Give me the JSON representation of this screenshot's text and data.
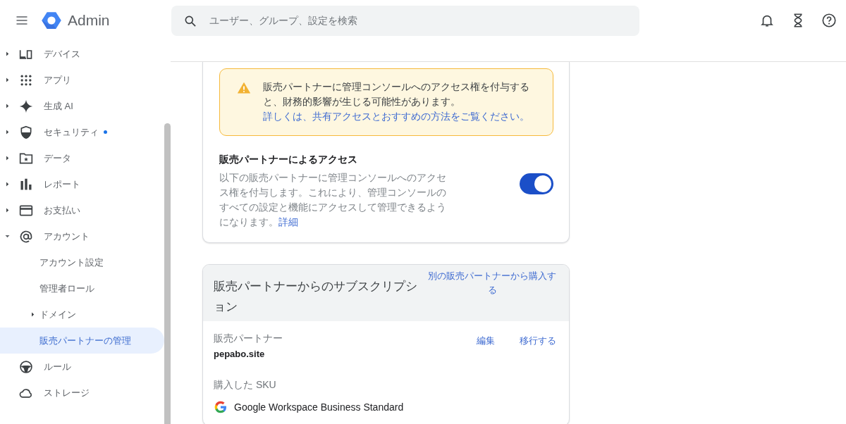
{
  "header": {
    "product": "Admin",
    "search": {
      "placeholder": "ユーザー、グループ、設定を検索"
    }
  },
  "sidebar": {
    "items": [
      {
        "label": "デバイス",
        "expandable": true,
        "expanded": false,
        "selected": false,
        "notification": false
      },
      {
        "label": "アプリ",
        "expandable": true,
        "expanded": false,
        "selected": false,
        "notification": false
      },
      {
        "label": "生成 AI",
        "expandable": true,
        "expanded": false,
        "selected": false,
        "notification": false
      },
      {
        "label": "セキュリティ",
        "expandable": true,
        "expanded": false,
        "selected": false,
        "notification": true
      },
      {
        "label": "データ",
        "expandable": true,
        "expanded": false,
        "selected": false,
        "notification": false
      },
      {
        "label": "レポート",
        "expandable": true,
        "expanded": false,
        "selected": false,
        "notification": false
      },
      {
        "label": "お支払い",
        "expandable": true,
        "expanded": false,
        "selected": false,
        "notification": false
      },
      {
        "label": "アカウント",
        "expandable": true,
        "expanded": true,
        "selected": false,
        "notification": false,
        "children": [
          {
            "label": "アカウント設定",
            "expandable": false,
            "expanded": false,
            "selected": false,
            "notification": false
          },
          {
            "label": "管理者ロール",
            "expandable": false,
            "expanded": false,
            "selected": false,
            "notification": false
          },
          {
            "label": "ドメイン",
            "expandable": true,
            "expanded": false,
            "selected": false,
            "notification": false
          },
          {
            "label": "販売パートナーの管理",
            "expandable": false,
            "expanded": false,
            "selected": true,
            "notification": false
          }
        ]
      },
      {
        "label": "ルール",
        "expandable": false,
        "expanded": false,
        "selected": false,
        "notification": false
      },
      {
        "label": "ストレージ",
        "expandable": false,
        "expanded": false,
        "selected": false,
        "notification": false
      }
    ]
  },
  "access_card": {
    "warning": {
      "text": "販売パートナーに管理コンソールへのアクセス権を付与すると、財務的影響が生じる可能性があります。",
      "link": "詳しくは、共有アクセスとおすすめの方法をご覧ください。"
    },
    "setting": {
      "title": "販売パートナーによるアクセス",
      "description": "以下の販売パートナーに管理コンソールへのアクセス権を付与します。これにより、管理コンソールのすべての設定と機能にアクセスして管理できるようになります。",
      "link": "詳細",
      "on": true
    }
  },
  "subscription_card": {
    "title": "販売パートナーからのサブスクリプション",
    "action": "別の販売パートナーから購入する",
    "reseller": {
      "label": "販売パートナー",
      "value": "pepabo.site",
      "actions": [
        "編集",
        "移行する"
      ]
    },
    "sku": {
      "label": "購入した SKU",
      "product": "Google Workspace Business Standard"
    }
  }
}
